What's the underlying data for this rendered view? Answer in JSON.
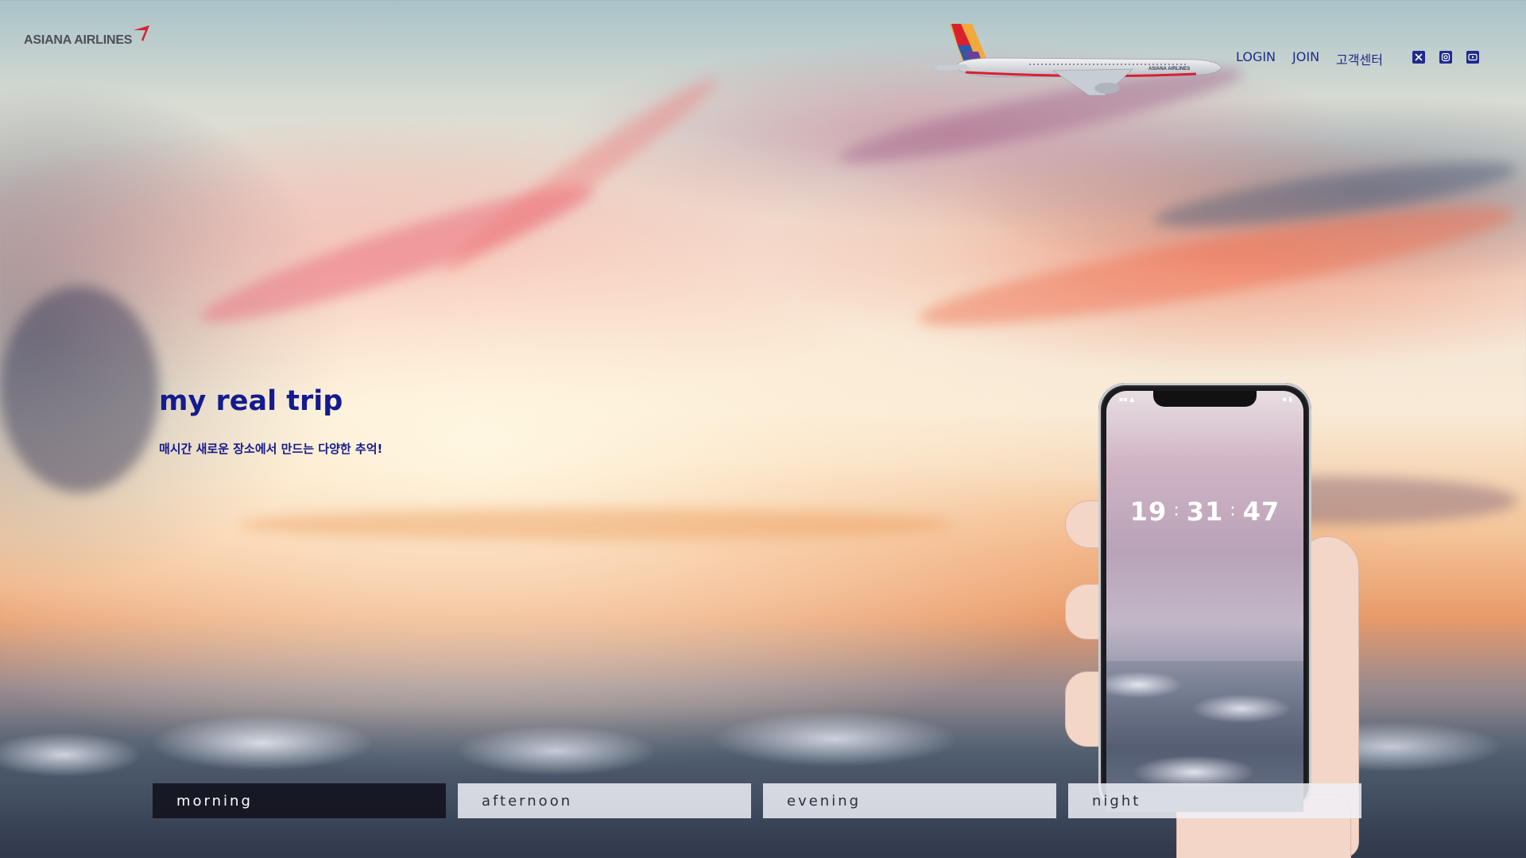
{
  "brand": {
    "name": "ASIANA AIRLINES",
    "accent_color": "#d8212f"
  },
  "header": {
    "nav": [
      {
        "label": "LOGIN"
      },
      {
        "label": "JOIN"
      },
      {
        "label": "고객센터"
      }
    ],
    "social": [
      {
        "icon": "x-twitter-icon"
      },
      {
        "icon": "instagram-icon"
      },
      {
        "icon": "youtube-icon"
      }
    ],
    "nav_color": "#1f2a8c"
  },
  "hero": {
    "title": "my real trip",
    "subtitle": "매시간 새로운 장소에서 만드는 다양한 추억!",
    "text_color": "#131b8e"
  },
  "phone": {
    "clock": {
      "hours": "19",
      "minutes": "31",
      "seconds": "47",
      "separator": ":"
    }
  },
  "tabs": [
    {
      "label": "morning",
      "active": true
    },
    {
      "label": "afternoon",
      "active": false
    },
    {
      "label": "evening",
      "active": false
    },
    {
      "label": "night",
      "active": false
    }
  ]
}
